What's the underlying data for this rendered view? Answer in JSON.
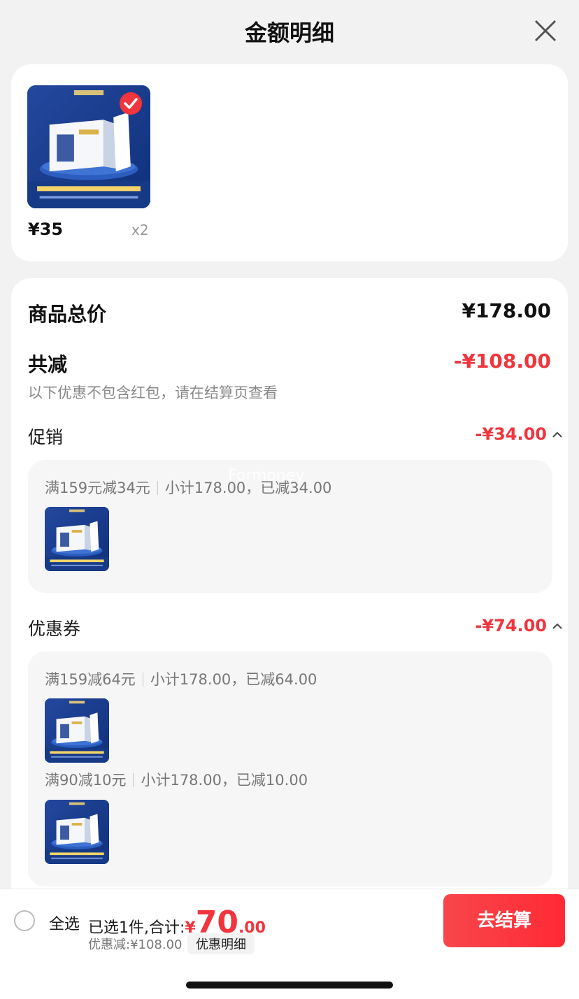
{
  "header": {
    "title": "金额明细"
  },
  "product": {
    "price": "¥35",
    "qty": "x2"
  },
  "totals": {
    "total_label": "商品总价",
    "total_value": "¥178.00",
    "reduce_label": "共减",
    "reduce_value": "-¥108.00",
    "reduce_note": "以下优惠不包含红包，请在结算页查看"
  },
  "promotion": {
    "label": "促销",
    "value": "-¥34.00",
    "rule": "满159元减34元",
    "subtotal": "小计178.00，已减34.00"
  },
  "coupon": {
    "label": "优惠券",
    "value": "-¥74.00",
    "items": [
      {
        "rule": "满159减64元",
        "subtotal": "小计178.00，已减64.00"
      },
      {
        "rule": "满90减10元",
        "subtotal": "小计178.00，已减10.00"
      }
    ]
  },
  "watermark": "Formoney",
  "bottom": {
    "select_all": "全选",
    "summary_prefix": "已选1件,合计:",
    "yen": "¥",
    "amount_int": "70",
    "amount_dec": ".00",
    "discount": "优惠减:¥108.00",
    "detail_chip": "优惠明细",
    "checkout": "去结算"
  },
  "colors": {
    "accent": "#f0353d",
    "background": "#f2f2f2"
  }
}
